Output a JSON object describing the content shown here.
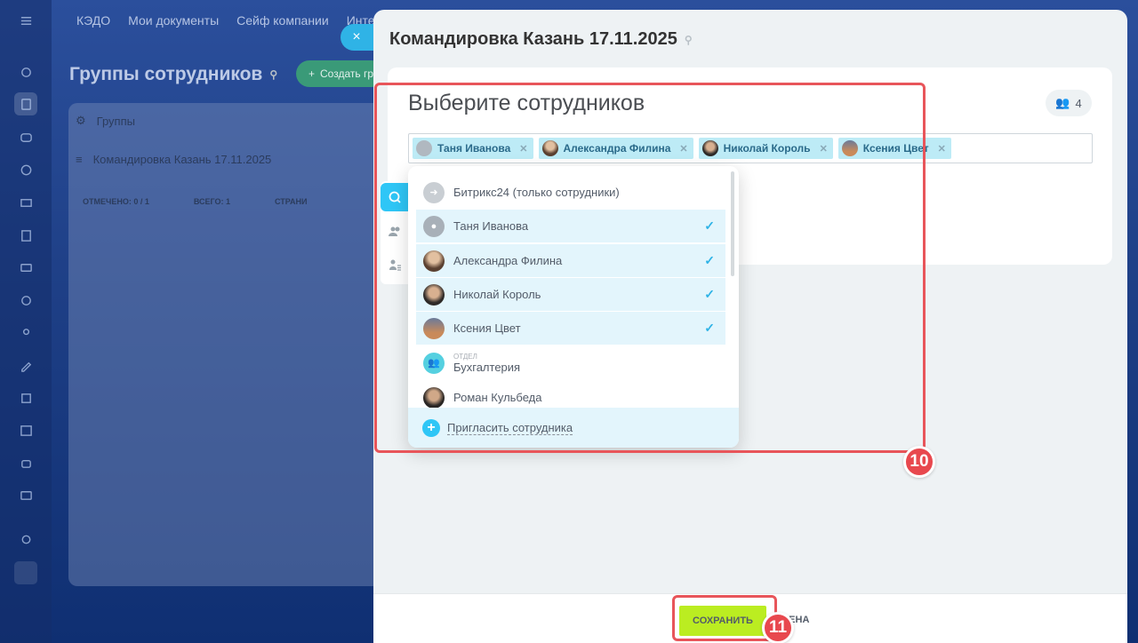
{
  "background": {
    "top_nav": [
      "КЭДО",
      "Мои документы",
      "Сейф компании",
      "Интегр"
    ],
    "page_title": "Группы сотрудников",
    "create_button": "Создать гр",
    "panel": {
      "header": "Группы",
      "row": "Командировка Казань 17.11.2025",
      "footer": {
        "checked": "ОТМЕЧЕНО: 0 / 1",
        "total": "ВСЕГО: 1",
        "pages": "СТРАНИ"
      }
    },
    "rail_icons": [
      "sync-icon",
      "document-icon",
      "chat-icon",
      "bitrix-icon",
      "mail-icon",
      "file-icon",
      "card-icon",
      "target-icon",
      "users-icon",
      "pen-icon",
      "checkbox-icon",
      "calendar-icon",
      "robot-icon",
      "wallet-icon",
      "settings-icon"
    ]
  },
  "slider": {
    "close_label": "×",
    "title": "Командировка Казань 17.11.2025",
    "card_title": "Выберите сотрудников",
    "count": "4",
    "tags": [
      {
        "name": "Таня Иванова",
        "avatar": "default"
      },
      {
        "name": "Александра Филина",
        "avatar": "photo"
      },
      {
        "name": "Николай Король",
        "avatar": "photo"
      },
      {
        "name": "Ксения Цвет",
        "avatar": "photo"
      }
    ],
    "footer": {
      "save": "СОХРАНИТЬ",
      "cancel": "МЕНА"
    }
  },
  "dropdown": {
    "items": [
      {
        "label": "Битрикс24 (только сотрудники)",
        "selected": false
      },
      {
        "label": "Таня Иванова",
        "selected": true
      },
      {
        "label": "Александра Филина",
        "selected": true
      },
      {
        "label": "Николай Король",
        "selected": true
      },
      {
        "label": "Ксения Цвет",
        "selected": true
      },
      {
        "label": "Бухгалтерия",
        "sup": "отдел",
        "selected": false
      },
      {
        "label": "Роман Кульбеда",
        "selected": false
      }
    ],
    "invite": "Пригласить сотрудника"
  },
  "annotations": {
    "step_10": "10",
    "step_11": "11"
  },
  "colors": {
    "accent": "#2fc6f6",
    "save": "#bbed21",
    "highlight": "#e8555a"
  }
}
